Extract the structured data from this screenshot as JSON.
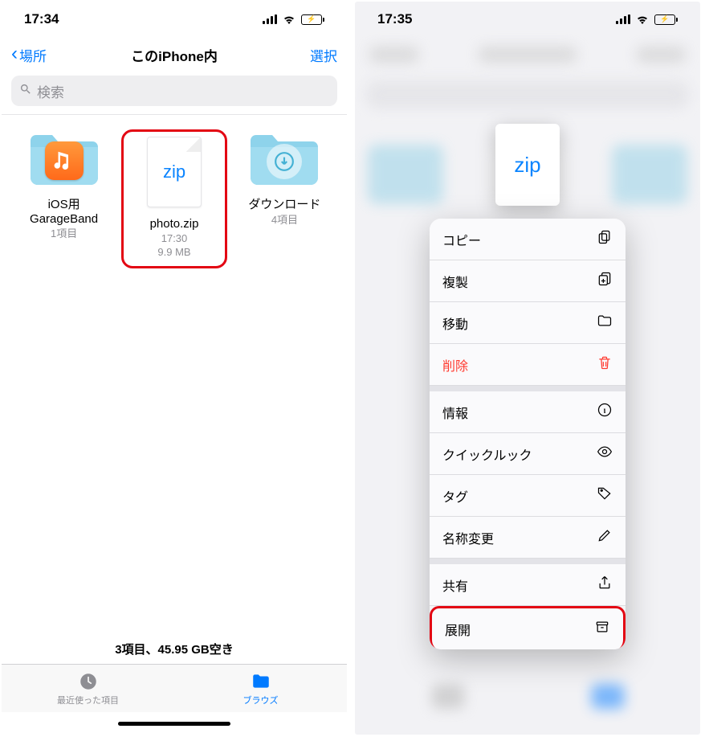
{
  "left": {
    "status_time": "17:34",
    "nav_back": "場所",
    "nav_title": "このiPhone内",
    "nav_select": "選択",
    "search_placeholder": "検索",
    "items": [
      {
        "name": "iOS用\nGarageBand",
        "meta": "1項目"
      },
      {
        "name": "photo.zip",
        "meta": "17:30\n9.9 MB",
        "zip_label": "zip"
      },
      {
        "name": "ダウンロード",
        "meta": "4項目"
      }
    ],
    "footer_space": "3項目、45.95 GB空き",
    "tab_recent": "最近使った項目",
    "tab_browse": "ブラウズ"
  },
  "right": {
    "status_time": "17:35",
    "zip_label": "zip",
    "menu": {
      "copy": "コピー",
      "duplicate": "複製",
      "move": "移動",
      "delete": "削除",
      "info": "情報",
      "quicklook": "クイックルック",
      "tags": "タグ",
      "rename": "名称変更",
      "share": "共有",
      "expand": "展開"
    }
  }
}
